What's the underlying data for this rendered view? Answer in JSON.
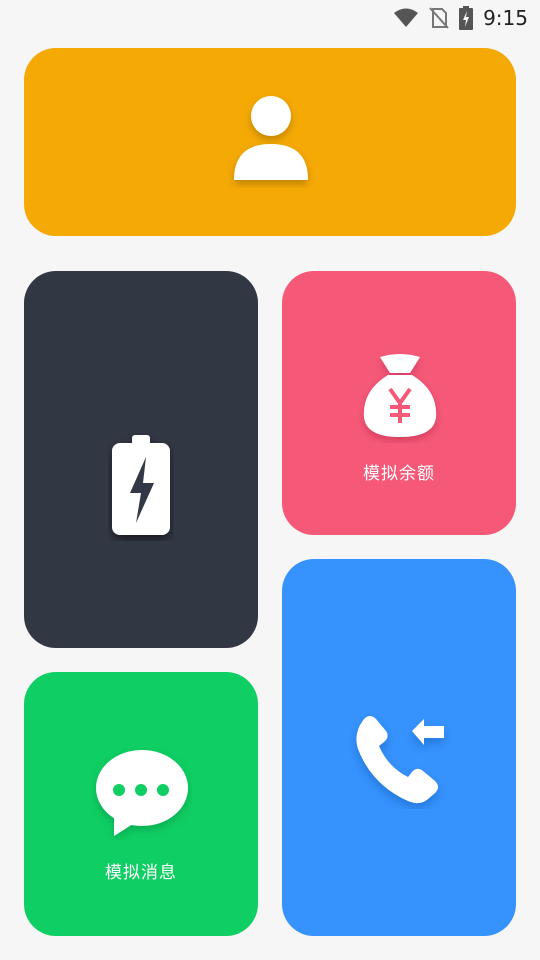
{
  "status_bar": {
    "time": "9:15",
    "icons": [
      "wifi-icon",
      "no-sim-icon",
      "battery-charging-icon"
    ]
  },
  "cards": {
    "profile": {
      "icon": "user-icon",
      "color": "#f5a905"
    },
    "battery": {
      "icon": "battery-charging-icon",
      "color": "#323744"
    },
    "money": {
      "icon": "money-bag-yuan-icon",
      "label": "模拟余额",
      "color": "#f65978"
    },
    "message": {
      "icon": "chat-bubble-icon",
      "label": "模拟消息",
      "color": "#0fce63"
    },
    "call": {
      "icon": "incoming-call-icon",
      "color": "#3693fd"
    }
  }
}
